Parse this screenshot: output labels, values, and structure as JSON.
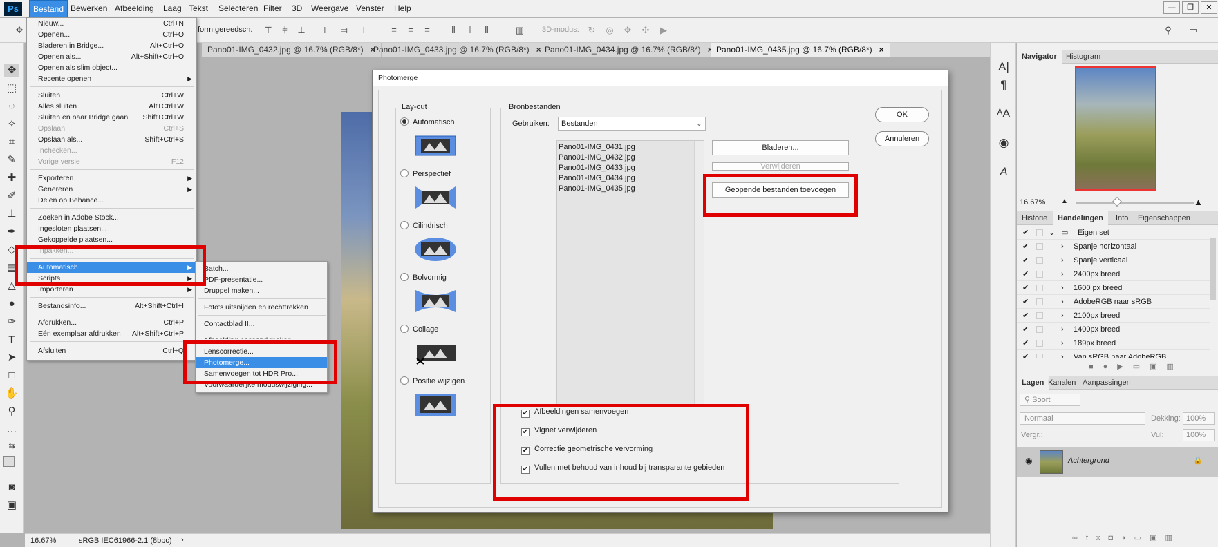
{
  "app": {
    "logo": "Ps"
  },
  "menubar": {
    "items": [
      "Bestand",
      "Bewerken",
      "Afbeelding",
      "Laag",
      "Tekst",
      "Selecteren",
      "Filter",
      "3D",
      "Weergave",
      "Venster",
      "Help"
    ],
    "window_buttons": [
      "—",
      "❐",
      "✕"
    ]
  },
  "optionsbar": {
    "label_transform": "form.gereedsch.",
    "label_3d": "3D-modus:"
  },
  "tabs": [
    "Pano01-IMG_0432.jpg @ 16.7% (RGB/8*)",
    "Pano01-IMG_0433.jpg @ 16.7% (RGB/8*)",
    "Pano01-IMG_0434.jpg @ 16.7% (RGB/8*)",
    "Pano01-IMG_0435.jpg @ 16.7% (RGB/8*)"
  ],
  "tab_close": "×",
  "statusbar": {
    "zoom": "16.67%",
    "profile": "sRGB IEC61966-2.1 (8bpc)",
    "arrow": "›"
  },
  "bestand_menu": {
    "items": [
      {
        "label": "Nieuw...",
        "shortcut": "Ctrl+N"
      },
      {
        "label": "Openen...",
        "shortcut": "Ctrl+O"
      },
      {
        "label": "Bladeren in Bridge...",
        "shortcut": "Alt+Ctrl+O"
      },
      {
        "label": "Openen als...",
        "shortcut": "Alt+Shift+Ctrl+O"
      },
      {
        "label": "Openen als slim object...",
        "shortcut": ""
      },
      {
        "label": "Recente openen",
        "shortcut": ""
      },
      {
        "label": "Sluiten",
        "shortcut": "Ctrl+W"
      },
      {
        "label": "Alles sluiten",
        "shortcut": "Alt+Ctrl+W"
      },
      {
        "label": "Sluiten en naar Bridge gaan...",
        "shortcut": "Shift+Ctrl+W"
      },
      {
        "label": "Opslaan",
        "shortcut": "Ctrl+S"
      },
      {
        "label": "Opslaan als...",
        "shortcut": "Shift+Ctrl+S"
      },
      {
        "label": "Inchecken...",
        "shortcut": ""
      },
      {
        "label": "Vorige versie",
        "shortcut": "F12"
      },
      {
        "label": "Exporteren",
        "shortcut": ""
      },
      {
        "label": "Genereren",
        "shortcut": ""
      },
      {
        "label": "Delen op Behance...",
        "shortcut": ""
      },
      {
        "label": "Zoeken in Adobe Stock...",
        "shortcut": ""
      },
      {
        "label": "Ingesloten plaatsen...",
        "shortcut": ""
      },
      {
        "label": "Gekoppelde plaatsen...",
        "shortcut": ""
      },
      {
        "label": "Inpakken...",
        "shortcut": ""
      },
      {
        "label": "Automatisch",
        "shortcut": ""
      },
      {
        "label": "Scripts",
        "shortcut": ""
      },
      {
        "label": "Importeren",
        "shortcut": ""
      },
      {
        "label": "Bestandsinfo...",
        "shortcut": "Alt+Shift+Ctrl+I"
      },
      {
        "label": "Afdrukken...",
        "shortcut": "Ctrl+P"
      },
      {
        "label": "Eén exemplaar afdrukken",
        "shortcut": "Alt+Shift+Ctrl+P"
      },
      {
        "label": "Afsluiten",
        "shortcut": "Ctrl+Q"
      }
    ],
    "submenu_arrow": "▶"
  },
  "automatisch_menu": {
    "items": [
      "Batch...",
      "PDF-presentatie...",
      "Druppel maken...",
      "Foto's uitsnijden en rechttrekken",
      "Contactblad II...",
      "Afbeelding passend maken...",
      "Lenscorrectie...",
      "Photomerge...",
      "Samenvoegen tot HDR Pro...",
      "Voorwaardelijke moduswijziging..."
    ]
  },
  "dialog": {
    "title": "Photomerge",
    "layout_group": "Lay-out",
    "layouts": [
      "Automatisch",
      "Perspectief",
      "Cilindrisch",
      "Bolvormig",
      "Collage",
      "Positie wijzigen"
    ],
    "source_group": "Bronbestanden",
    "use_label": "Gebruiken:",
    "use_value": "Bestanden",
    "files": [
      "Pano01-IMG_0431.jpg",
      "Pano01-IMG_0432.jpg",
      "Pano01-IMG_0433.jpg",
      "Pano01-IMG_0434.jpg",
      "Pano01-IMG_0435.jpg"
    ],
    "browse": "Bladeren...",
    "remove": "Verwijderen",
    "add_open": "Geopende bestanden toevoegen",
    "ok": "OK",
    "cancel": "Annuleren",
    "options": [
      "Afbeeldingen samenvoegen",
      "Vignet verwijderen",
      "Correctie geometrische vervorming",
      "Vullen met behoud van inhoud bij transparante gebieden"
    ]
  },
  "navigator": {
    "tabs": [
      "Navigator",
      "Histogram"
    ],
    "zoom": "16.67%"
  },
  "actions": {
    "tabs": [
      "Historie",
      "Handelingen",
      "Info",
      "Eigenschappen"
    ],
    "set": "Eigen set",
    "items": [
      "Spanje horizontaal",
      "Spanje verticaal",
      "2400px breed",
      "1600 px breed",
      "AdobeRGB naar sRGB",
      "2100px breed",
      "1400px breed",
      "189px breed",
      "Van sRGB naar AdobeRGB"
    ]
  },
  "layers": {
    "tabs": [
      "Lagen",
      "Kanalen",
      "Aanpassingen"
    ],
    "filter": "Soort",
    "blend": "Normaal",
    "opacity_label": "Dekking:",
    "opacity": "100%",
    "lock_label": "Vergr.:",
    "fill_label": "Vul:",
    "fill": "100%",
    "layer_name": "Achtergrond"
  }
}
